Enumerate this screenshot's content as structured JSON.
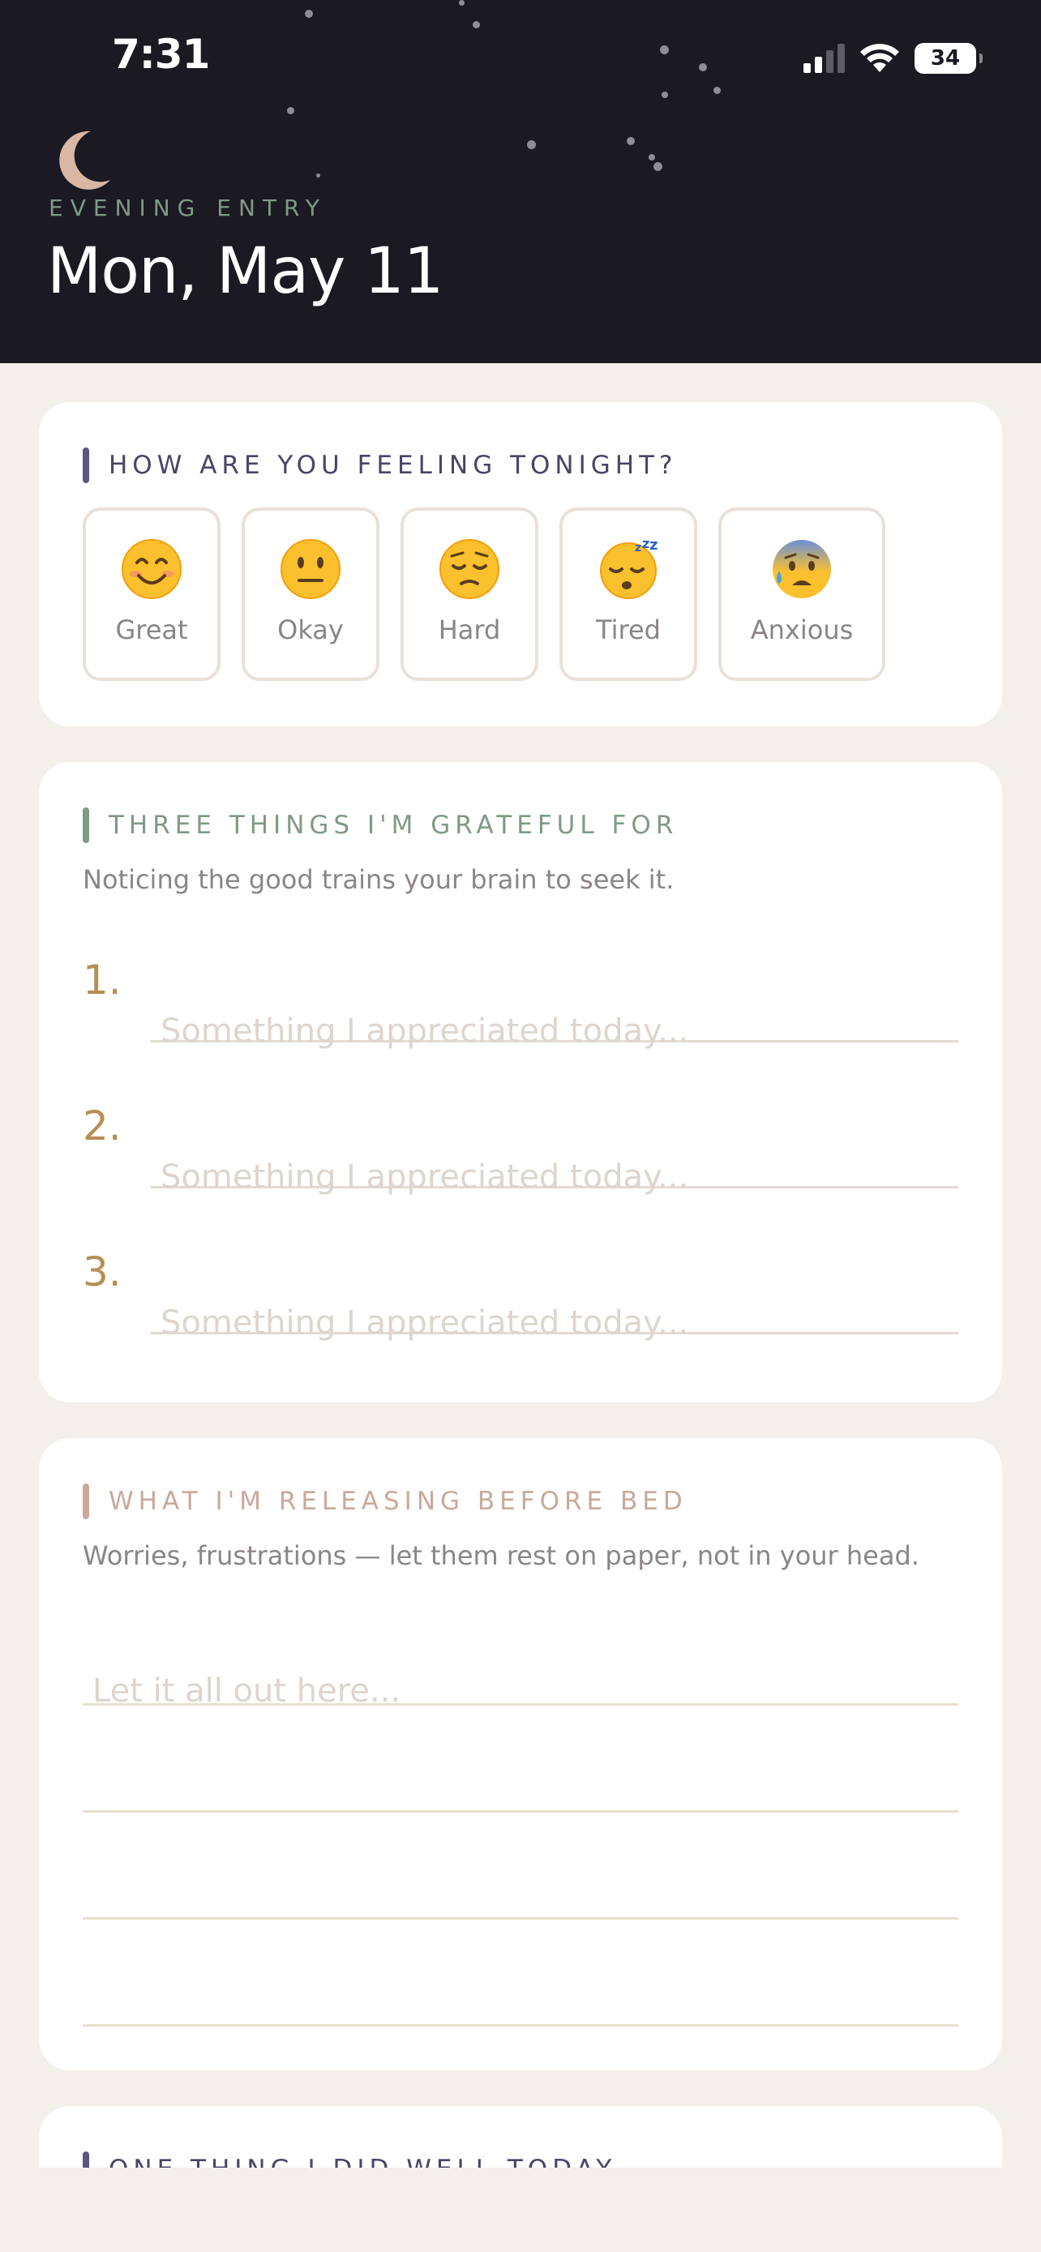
{
  "status_bar": {
    "time": "7:31",
    "battery": "34"
  },
  "header": {
    "label": "EVENING ENTRY",
    "date": "Mon, May 11"
  },
  "mood": {
    "title": "HOW ARE YOU FEELING TONIGHT?",
    "options": [
      {
        "label": "Great",
        "icon": "smiling-face-icon"
      },
      {
        "label": "Okay",
        "icon": "neutral-face-icon"
      },
      {
        "label": "Hard",
        "icon": "pensive-face-icon"
      },
      {
        "label": "Tired",
        "icon": "sleeping-face-icon"
      },
      {
        "label": "Anxious",
        "icon": "anxious-sweat-face-icon"
      }
    ]
  },
  "grateful": {
    "title": "THREE THINGS I'M GRATEFUL FOR",
    "subtitle": "Noticing the good trains your brain to seek it.",
    "items": [
      {
        "number": "1.",
        "placeholder": "Something I appreciated today..."
      },
      {
        "number": "2.",
        "placeholder": "Something I appreciated today..."
      },
      {
        "number": "3.",
        "placeholder": "Something I appreciated today..."
      }
    ]
  },
  "releasing": {
    "title": "WHAT I'M RELEASING BEFORE BED",
    "subtitle": "Worries, frustrations — let them rest on paper, not in your head.",
    "placeholder": "Let it all out here..."
  },
  "did_well": {
    "title": "ONE THING I DID WELL TODAY"
  },
  "colors": {
    "header_bg": "#1b1922",
    "mood_accent": "#5d5480",
    "grateful_accent": "#7f9a85",
    "release_accent": "#c9a99a",
    "number_gold": "#b58f55"
  }
}
